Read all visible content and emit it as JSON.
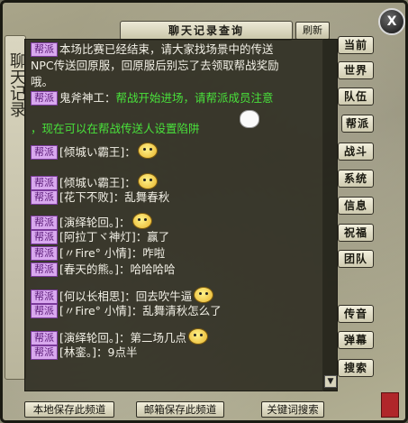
{
  "window": {
    "title": "聊天记录查询",
    "refresh_label": "刷新",
    "close_label": "X",
    "side_text": "聊天记录"
  },
  "messages": [
    {
      "tag": "帮派",
      "text": "本场比赛已经结束，请大家找场景中的传送"
    },
    {
      "text": "NPC传送回原服，回原服后别忘了去领取帮战奖励"
    },
    {
      "text": "哦。"
    },
    {
      "tag": "帮派",
      "speaker": "鬼斧神工：",
      "text": "帮战开始进场，请帮派成员注意"
    },
    {
      "text": "，现在可以在帮战传送人设置陷阱"
    },
    {
      "tag": "帮派",
      "speaker": "[倾城い霸王]：",
      "text": ""
    },
    {
      "tag": "帮派",
      "speaker": "[倾城い霸王]：",
      "text": ""
    },
    {
      "tag": "帮派",
      "speaker": "[花下不败]：",
      "text": "乱舞春秋"
    },
    {
      "tag": "帮派",
      "speaker": "[演绎轮回。]：",
      "text": ""
    },
    {
      "tag": "帮派",
      "speaker": "[阿拉丁ヾ神灯]：",
      "text": "赢了"
    },
    {
      "tag": "帮派",
      "speaker": "[〃Fire° 小情]：",
      "text": "咋啦"
    },
    {
      "tag": "帮派",
      "speaker": "[春天的熊。]：",
      "text": "哈哈哈哈"
    },
    {
      "tag": "帮派",
      "speaker": "[何以长相思]：",
      "text": "回去吹牛逼"
    },
    {
      "tag": "帮派",
      "speaker": "[〃Fire° 小情]：",
      "text": "乱舞清秋怎么了"
    },
    {
      "tag": "帮派",
      "speaker": "[演绎轮回。]：",
      "text": "第二场几点"
    },
    {
      "tag": "帮派",
      "speaker": "[林銮。]：",
      "text": "9点半"
    }
  ],
  "channels": [
    "当前",
    "世界",
    "队伍",
    "帮派",
    "战斗",
    "系统",
    "信息",
    "祝福",
    "团队",
    "传音",
    "弹幕",
    "搜索"
  ],
  "bottom_buttons": [
    "本地保存此频道",
    "邮箱保存此频道",
    "关键词搜索"
  ],
  "colors": {
    "tag_bg": "#d8a8ee",
    "system_green": "#49e23b",
    "chat_bg": "#2a281c"
  }
}
